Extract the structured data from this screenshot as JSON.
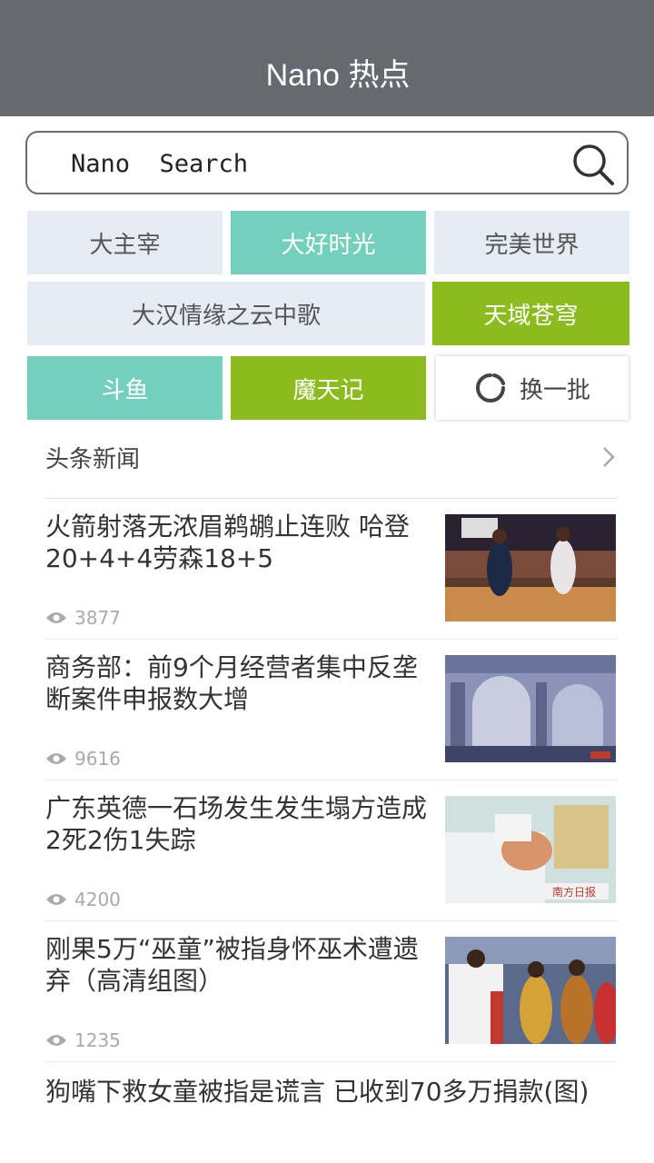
{
  "app": {
    "title": "Nano 热点"
  },
  "search": {
    "placeholder": "Nano  Search"
  },
  "hot_tags": [
    {
      "label": "大主宰"
    },
    {
      "label": "大好时光"
    },
    {
      "label": "完美世界"
    },
    {
      "label": "大汉情缘之云中歌"
    },
    {
      "label": "天域苍穹"
    },
    {
      "label": "斗鱼"
    },
    {
      "label": "魔天记"
    }
  ],
  "refresh": {
    "label": "换一批"
  },
  "section": {
    "title": "头条新闻"
  },
  "news": [
    {
      "title": "火箭射落无浓眉鹈鹕止连败 哈登20+4+4劳森18+5",
      "views": "3877",
      "thumb": "basketball-photo"
    },
    {
      "title": "商务部：前9个月经营者集中反垄断案件申报数大增",
      "views": "9616",
      "thumb": "arch-building-photo"
    },
    {
      "title": "广东英德一石场发生发生塌方造成2死2伤1失踪",
      "views": "4200",
      "thumb": "hospital-patient-photo"
    },
    {
      "title": "刚果5万“巫童”被指身怀巫术遭遗弃（高清组图）",
      "views": "1235",
      "thumb": "church-crowd-photo"
    },
    {
      "title": "狗嘴下救女童被指是谎言 已收到70多万捐款(图)"
    }
  ],
  "colors": {
    "appbar": "#666a70",
    "tag_gray": "#e6ecf3",
    "tag_teal": "#74cfbc",
    "tag_green": "#8bbb1d"
  }
}
